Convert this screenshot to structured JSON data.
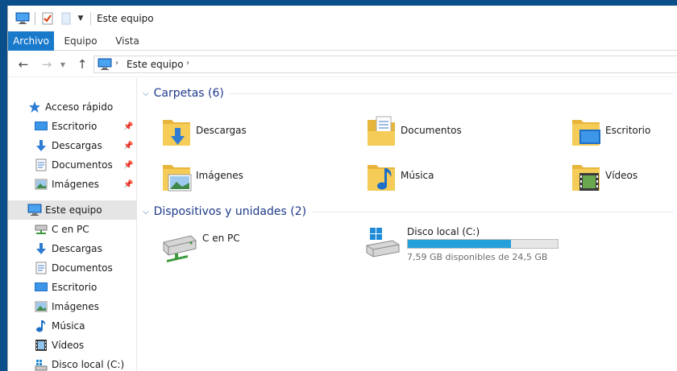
{
  "window": {
    "title": "Este equipo"
  },
  "ribbon": {
    "tabs": [
      {
        "label": "Archivo"
      },
      {
        "label": "Equipo"
      },
      {
        "label": "Vista"
      }
    ]
  },
  "address": {
    "path": "Este equipo"
  },
  "sidebar": {
    "quick_access": {
      "label": "Acceso rápido",
      "items": [
        {
          "label": "Escritorio",
          "icon": "desktop-icon",
          "pinned": true
        },
        {
          "label": "Descargas",
          "icon": "download-arrow-icon",
          "pinned": true
        },
        {
          "label": "Documentos",
          "icon": "document-icon",
          "pinned": true
        },
        {
          "label": "Imágenes",
          "icon": "pictures-icon",
          "pinned": true
        }
      ]
    },
    "this_pc": {
      "label": "Este equipo",
      "items": [
        {
          "label": "C en PC",
          "icon": "network-drive-icon"
        },
        {
          "label": "Descargas",
          "icon": "download-arrow-icon"
        },
        {
          "label": "Documentos",
          "icon": "document-icon"
        },
        {
          "label": "Escritorio",
          "icon": "desktop-icon"
        },
        {
          "label": "Imágenes",
          "icon": "pictures-icon"
        },
        {
          "label": "Música",
          "icon": "music-note-icon"
        },
        {
          "label": "Vídeos",
          "icon": "film-icon"
        },
        {
          "label": "Disco local (C:)",
          "icon": "local-disk-icon"
        }
      ]
    }
  },
  "content": {
    "folders_group": {
      "title": "Carpetas (6)",
      "items": [
        {
          "label": "Descargas",
          "icon": "downloads-folder-icon"
        },
        {
          "label": "Documentos",
          "icon": "documents-folder-icon"
        },
        {
          "label": "Escritorio",
          "icon": "desktop-folder-icon"
        },
        {
          "label": "Imágenes",
          "icon": "pictures-folder-icon"
        },
        {
          "label": "Música",
          "icon": "music-folder-icon"
        },
        {
          "label": "Vídeos",
          "icon": "videos-folder-icon"
        }
      ]
    },
    "devices_group": {
      "title": "Dispositivos y unidades (2)",
      "items": [
        {
          "label": "C en PC",
          "icon": "network-drive-icon"
        },
        {
          "label": "Disco local (C:)",
          "icon": "windows-drive-icon",
          "free_text": "7,59 GB disponibles de 24,5 GB",
          "used_fraction": 0.69
        }
      ]
    }
  },
  "colors": {
    "accent": "#1979ca",
    "folder": "#f5cc57",
    "drive_bar": "#26a0da",
    "group_title": "#1e3a8a"
  }
}
